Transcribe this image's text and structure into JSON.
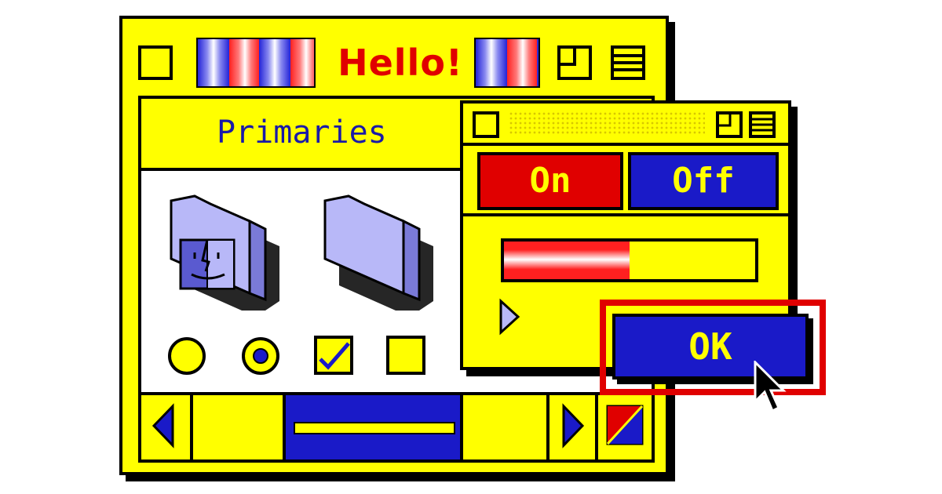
{
  "window": {
    "title": "Hello!",
    "panel_title": "Primaries"
  },
  "popup": {
    "on_label": "On",
    "off_label": "Off",
    "progress": 0.5,
    "ok_label": "OK"
  },
  "colors": {
    "yellow": "#ffff00",
    "blue": "#1a1ac8",
    "red": "#e00000",
    "lavender": "#b8b8f8"
  },
  "icons": [
    "finder-folder-icon",
    "folder-icon",
    "radio-empty-icon",
    "radio-selected-icon",
    "checkbox-checked-icon",
    "checkbox-empty-icon",
    "scroll-left-icon",
    "scroll-right-icon",
    "resize-icon",
    "play-icon",
    "cursor-icon"
  ]
}
